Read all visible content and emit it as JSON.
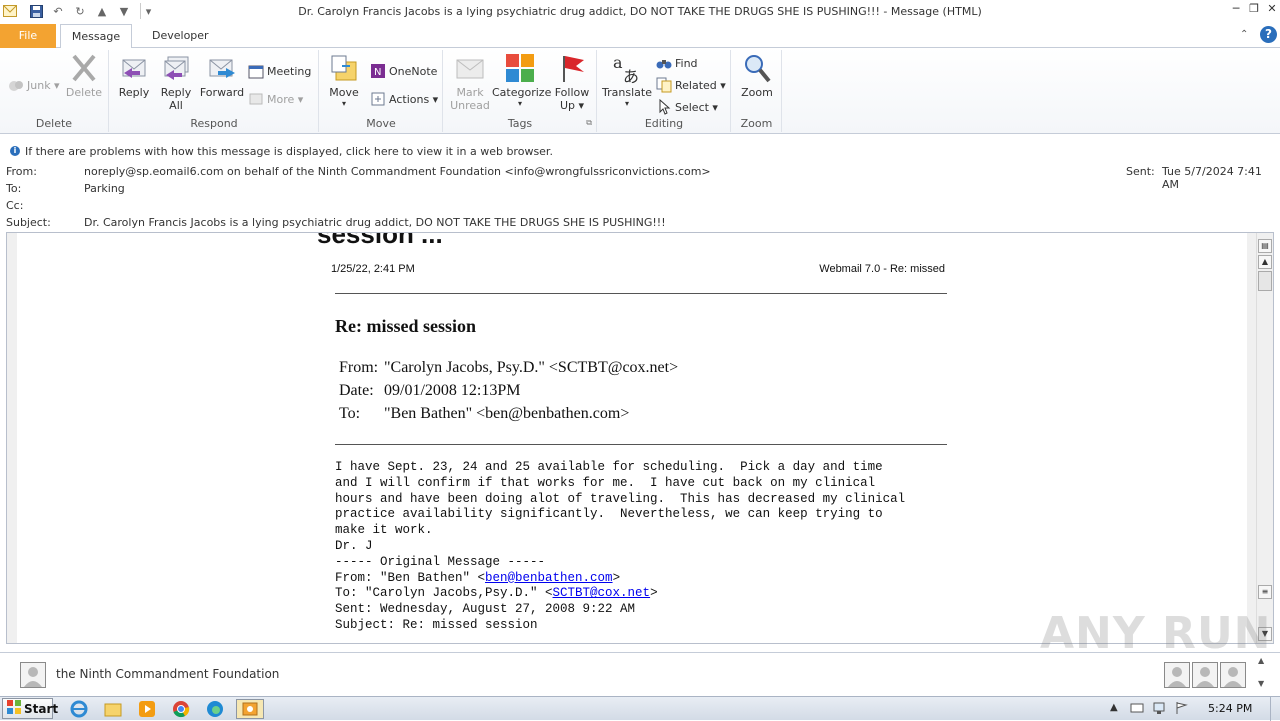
{
  "window": {
    "title": "Dr. Carolyn Francis Jacobs is a lying psychiatric drug addict, DO NOT TAKE THE DRUGS SHE IS PUSHING!!! - Message (HTML)"
  },
  "tabs": {
    "file": "File",
    "message": "Message",
    "developer": "Developer"
  },
  "ribbon": {
    "delete_group": {
      "label": "Delete",
      "junk": "Junk",
      "delete": "Delete"
    },
    "respond_group": {
      "label": "Respond",
      "reply": "Reply",
      "reply_all_line1": "Reply",
      "reply_all_line2": "All",
      "forward": "Forward",
      "meeting": "Meeting",
      "more": "More"
    },
    "move_group": {
      "label": "Move",
      "move": "Move",
      "onenote": "OneNote",
      "actions": "Actions"
    },
    "tags_group": {
      "label": "Tags",
      "mark_unread_line1": "Mark",
      "mark_unread_line2": "Unread",
      "categorize": "Categorize",
      "follow_up_line1": "Follow",
      "follow_up_line2": "Up"
    },
    "editing_group": {
      "label": "Editing",
      "translate": "Translate",
      "find": "Find",
      "related": "Related",
      "select": "Select"
    },
    "zoom_group": {
      "label": "Zoom",
      "zoom": "Zoom"
    }
  },
  "infobar": {
    "text": "If there are problems with how this message is displayed, click here to view it in a web browser."
  },
  "header": {
    "from_label": "From:",
    "from_value": "noreply@sp.eomail6.com on behalf of the Ninth Commandment Foundation <info@wrongfulssriconvictions.com>",
    "to_label": "To:",
    "to_value": "Parking",
    "cc_label": "Cc:",
    "cc_value": "",
    "subject_label": "Subject:",
    "subject_value": "Dr. Carolyn Francis Jacobs is a lying psychiatric drug addict, DO NOT TAKE THE DRUGS SHE IS PUSHING!!!",
    "sent_label": "Sent:",
    "sent_value": "Tue 5/7/2024 7:41 AM"
  },
  "doc": {
    "cut_heading": "session ...",
    "print_date": "1/25/22, 2:41 PM",
    "print_app": "Webmail 7.0 - Re: missed",
    "subject": "Re: missed session",
    "from_label": "From:",
    "from_value": "\"Carolyn Jacobs, Psy.D.\" <SCTBT@cox.net>",
    "date_label": "Date:",
    "date_value": "09/01/2008 12:13PM",
    "to_label": "To:",
    "to_value": "\"Ben Bathen\" <ben@benbathen.com>",
    "body_lines": [
      "I have Sept. 23, 24 and 25 available for scheduling.  Pick a day and time",
      "and I will confirm if that works for me.  I have cut back on my clinical",
      "hours and have been doing alot of traveling.  This has decreased my clinical",
      "practice availability significantly.  Nevertheless, we can keep trying to",
      "make it work.",
      "Dr. J",
      "----- Original Message -----"
    ],
    "orig_from_prefix": "From: \"Ben Bathen\" <",
    "orig_from_link": "ben@benbathen.com",
    "orig_from_suffix": ">",
    "orig_to_prefix": "To: \"Carolyn Jacobs,Psy.D.\" <",
    "orig_to_link": "SCTBT@cox.net",
    "orig_to_suffix": ">",
    "orig_sent": "Sent: Wednesday, August 27, 2008 9:22 AM",
    "orig_subject": "Subject: Re: missed session"
  },
  "people_pane": {
    "name": "the Ninth Commandment Foundation"
  },
  "taskbar": {
    "start": "Start",
    "clock": "5:24 PM"
  },
  "watermark": "ANY RUN",
  "colors": {
    "file_tab": "#f3a331",
    "link": "#0000ee",
    "accent_blue": "#2a6ebb"
  }
}
